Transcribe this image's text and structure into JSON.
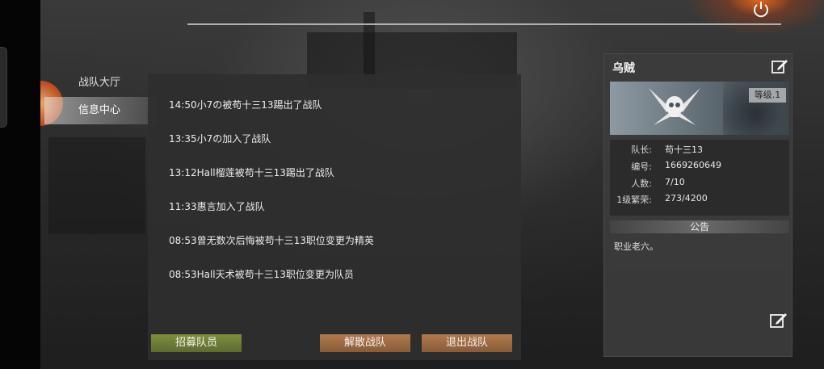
{
  "nav": {
    "items": [
      {
        "label": "战队大厅"
      },
      {
        "label": "信息中心"
      }
    ]
  },
  "messages": [
    "14:50小7の被苟十三13踢出了战队",
    "13:35小7の加入了战队",
    "13:12Hall榴莲被苟十三13踢出了战队",
    "11:33惠言加入了战队",
    "08:53曾无数次后悔被苟十三13职位变更为精英",
    "08:53Hall天术被苟十三13职位变更为队员"
  ],
  "buttons": {
    "recruit": "招募队员",
    "disband": "解散战队",
    "quit": "退出战队"
  },
  "team": {
    "name": "乌贼",
    "level": "等级.1",
    "captain_label": "队长:",
    "captain": "苟十三13",
    "id_label": "编号:",
    "id": "1669260649",
    "members_label": "人数:",
    "members": "7/10",
    "prosperity_label": "1级繁荣:",
    "prosperity": "273/4200",
    "notice_title": "公告",
    "notice": "职业老六。"
  },
  "icons": {
    "power": "power-icon",
    "edit": "edit-icon",
    "emblem": "skull-emblem-icon"
  },
  "colors": {
    "recruit_button": "#7d8e3e",
    "action_button": "#b07a4d",
    "panel": "#2e2e2e"
  }
}
